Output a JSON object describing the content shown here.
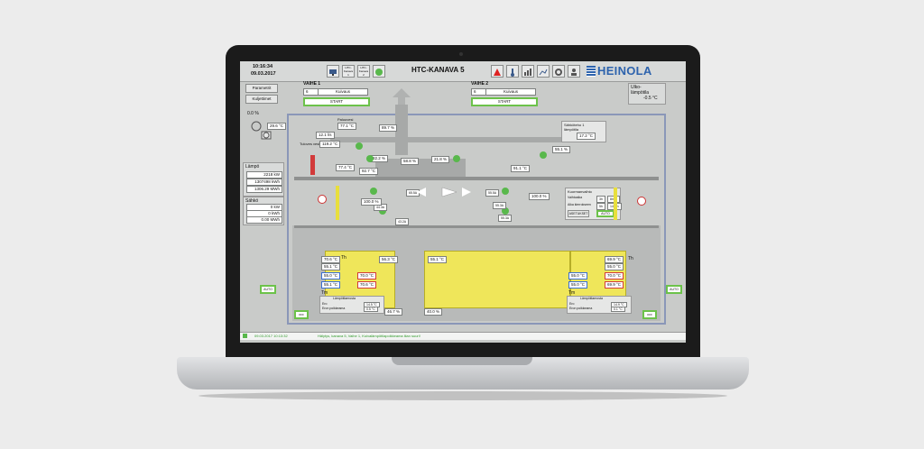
{
  "header": {
    "time": "10:16:34",
    "date": "09.03.2017",
    "title": "HTC-KANAVA 5",
    "brand": "HEINOLA",
    "nav_btn1": "HTC-Kanava",
    "nav_btn2": "HTC-Kanava",
    "nav_btn1_num": "1",
    "nav_btn2_num": "2"
  },
  "left_panel": {
    "btn_parametrit": "Parametrit",
    "btn_kuljettimet": "Kuljettimet",
    "percent": "0.0 %",
    "temp1": "29.6 °C",
    "lampo_title": "Lämpö",
    "lampo_kw": "2218 kW",
    "lampo_kwh": "1307498 kWh",
    "lampo_mwh": "1306.29 MWh",
    "sahko_title": "Sähkö",
    "sahko_kw": "0 kW",
    "sahko_kwh": "0 kWh",
    "sahko_mwh": "0.00 MWh",
    "auto_label": "AUTO",
    "off_label": "OFF"
  },
  "phase1": {
    "title": "VAIHE 1",
    "num": "6",
    "label": "Kuivaus",
    "start": "START"
  },
  "phase2": {
    "title": "VAIHE 2",
    "num": "6",
    "label": "Kuivaus",
    "start": "START"
  },
  "outdoor": {
    "label1": "Ulko-",
    "label2": "lämpötila",
    "value": "-0.5 °C"
  },
  "process": {
    "paluu_label": "Paluuvesi",
    "paluu": "77.1 °C",
    "flow": "12.1 l/s",
    "tuloves_label": "Tuloves vesi",
    "tuloves": "119.2 °C",
    "top_temp": "89.7 %",
    "t_left": "77.4 °C",
    "pct_left": "92.7 °C",
    "pct_a": "82.2 %",
    "pct_b": "58.8 %",
    "pct_c": "21.8 %",
    "right_pct": "55.1 %",
    "right_temp": "91.1 °C",
    "heat_label1": "Sähköteho 1",
    "heat_label2": "lämpötila",
    "heat_val": "17.2 °C",
    "small_a": "65.5A",
    "small_b": "44.3A",
    "small_c": "55.5A",
    "small_d": "55.3A",
    "small_e": "43.2A",
    "small_f": "55.3A",
    "pct_100a": "100.0 %",
    "pct_100b": "100.0 %",
    "kuorma_title": "Kuormanvaihto",
    "kuorma_row1": "Vaihtoaika",
    "kuorma_v1": "3h",
    "kuorma_v1b": "8min",
    "kuorma_row2": "Aika kierrokseen",
    "kuorma_v2": "5h",
    "kuorma_v2b": "14min",
    "asetukset": "ASETUKSET",
    "auto": "AUTO"
  },
  "left_stack": {
    "t1": "70.6 °C",
    "t2": "55.1 °C",
    "t3": "55.0 °C",
    "t4": "55.1 °C",
    "t5": "70.0 °C",
    "t6": "70.6 °C",
    "top_right": "56.3 °C",
    "th": "Th",
    "tm": "Tm",
    "tk_label": "Lämpötilaerosta",
    "ero_label": "Ero",
    "ero_pk_label": "Eron poikkeama",
    "ero_val": "14.5 °C",
    "ero_pk_val": "0.5 °C",
    "bottom_a": "46.7 %",
    "bottom_b": "40.0 %",
    "center": "55.1 °C"
  },
  "right_stack": {
    "t1": "69.9 °C",
    "t2": "55.0 °C",
    "t3": "55.0 °C",
    "t4": "55.0 °C",
    "t5": "70.0 °C",
    "t6": "69.9 °C",
    "th": "Th",
    "tm": "Tm",
    "tk_label": "Lämpötilaerosta",
    "ero_label": "Ero",
    "ero_pk_label": "Eron poikkeama",
    "ero_val": "14.9 °C",
    "ero_pk_val": "0.1 °C"
  },
  "status": {
    "time": "09.03.2017 10:13:32",
    "message": "Hälytys, kanava 5, Vaihe 1, Kuivalämpötilapoikkeama liian suuri!"
  }
}
